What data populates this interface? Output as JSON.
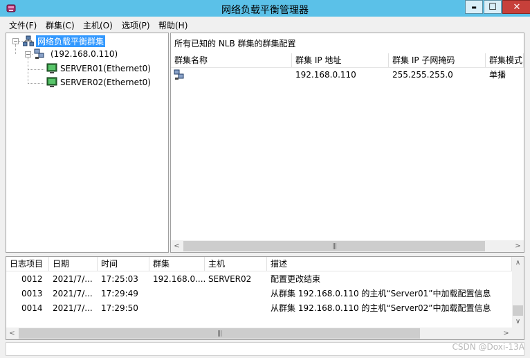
{
  "window": {
    "title": "网络负载平衡管理器",
    "minimize": "▬",
    "maximize": "☐",
    "close": "✕"
  },
  "menu": {
    "items": [
      "文件(F)",
      "群集(C)",
      "主机(O)",
      "选项(P)",
      "帮助(H)"
    ]
  },
  "tree": {
    "root": "网络负载平衡群集",
    "cluster": "(192.168.0.110)",
    "hosts": [
      "SERVER01(Ethernet0)",
      "SERVER02(Ethernet0)"
    ],
    "collapse_glyph": "−"
  },
  "right_pane": {
    "caption": "所有已知的 NLB 群集的群集配置",
    "columns": [
      "群集名称",
      "群集 IP 地址",
      "群集 IP 子网掩码",
      "群集模式"
    ],
    "rows": [
      {
        "name": "",
        "ip": "192.168.0.110",
        "mask": "255.255.255.0",
        "mode": "单播"
      }
    ]
  },
  "log_pane": {
    "columns": [
      "日志项目",
      "日期",
      "时间",
      "群集",
      "主机",
      "描述"
    ],
    "rows": [
      {
        "id": "0012",
        "date": "2021/7/...",
        "time": "17:25:03",
        "cluster": "192.168.0....",
        "host": "SERVER02",
        "desc": "配置更改结束"
      },
      {
        "id": "0013",
        "date": "2021/7/...",
        "time": "17:29:49",
        "cluster": "",
        "host": "",
        "desc": "从群集 192.168.0.110 的主机“Server01”中加载配置信息"
      },
      {
        "id": "0014",
        "date": "2021/7/...",
        "time": "17:29:50",
        "cluster": "",
        "host": "",
        "desc": "从群集 192.168.0.110 的主机“Server02”中加载配置信息"
      }
    ]
  },
  "scroll": {
    "left": "<",
    "right": ">",
    "up": "∧",
    "down": "∨",
    "grip": "|||"
  },
  "watermark": "CSDN @Doxi-13A"
}
